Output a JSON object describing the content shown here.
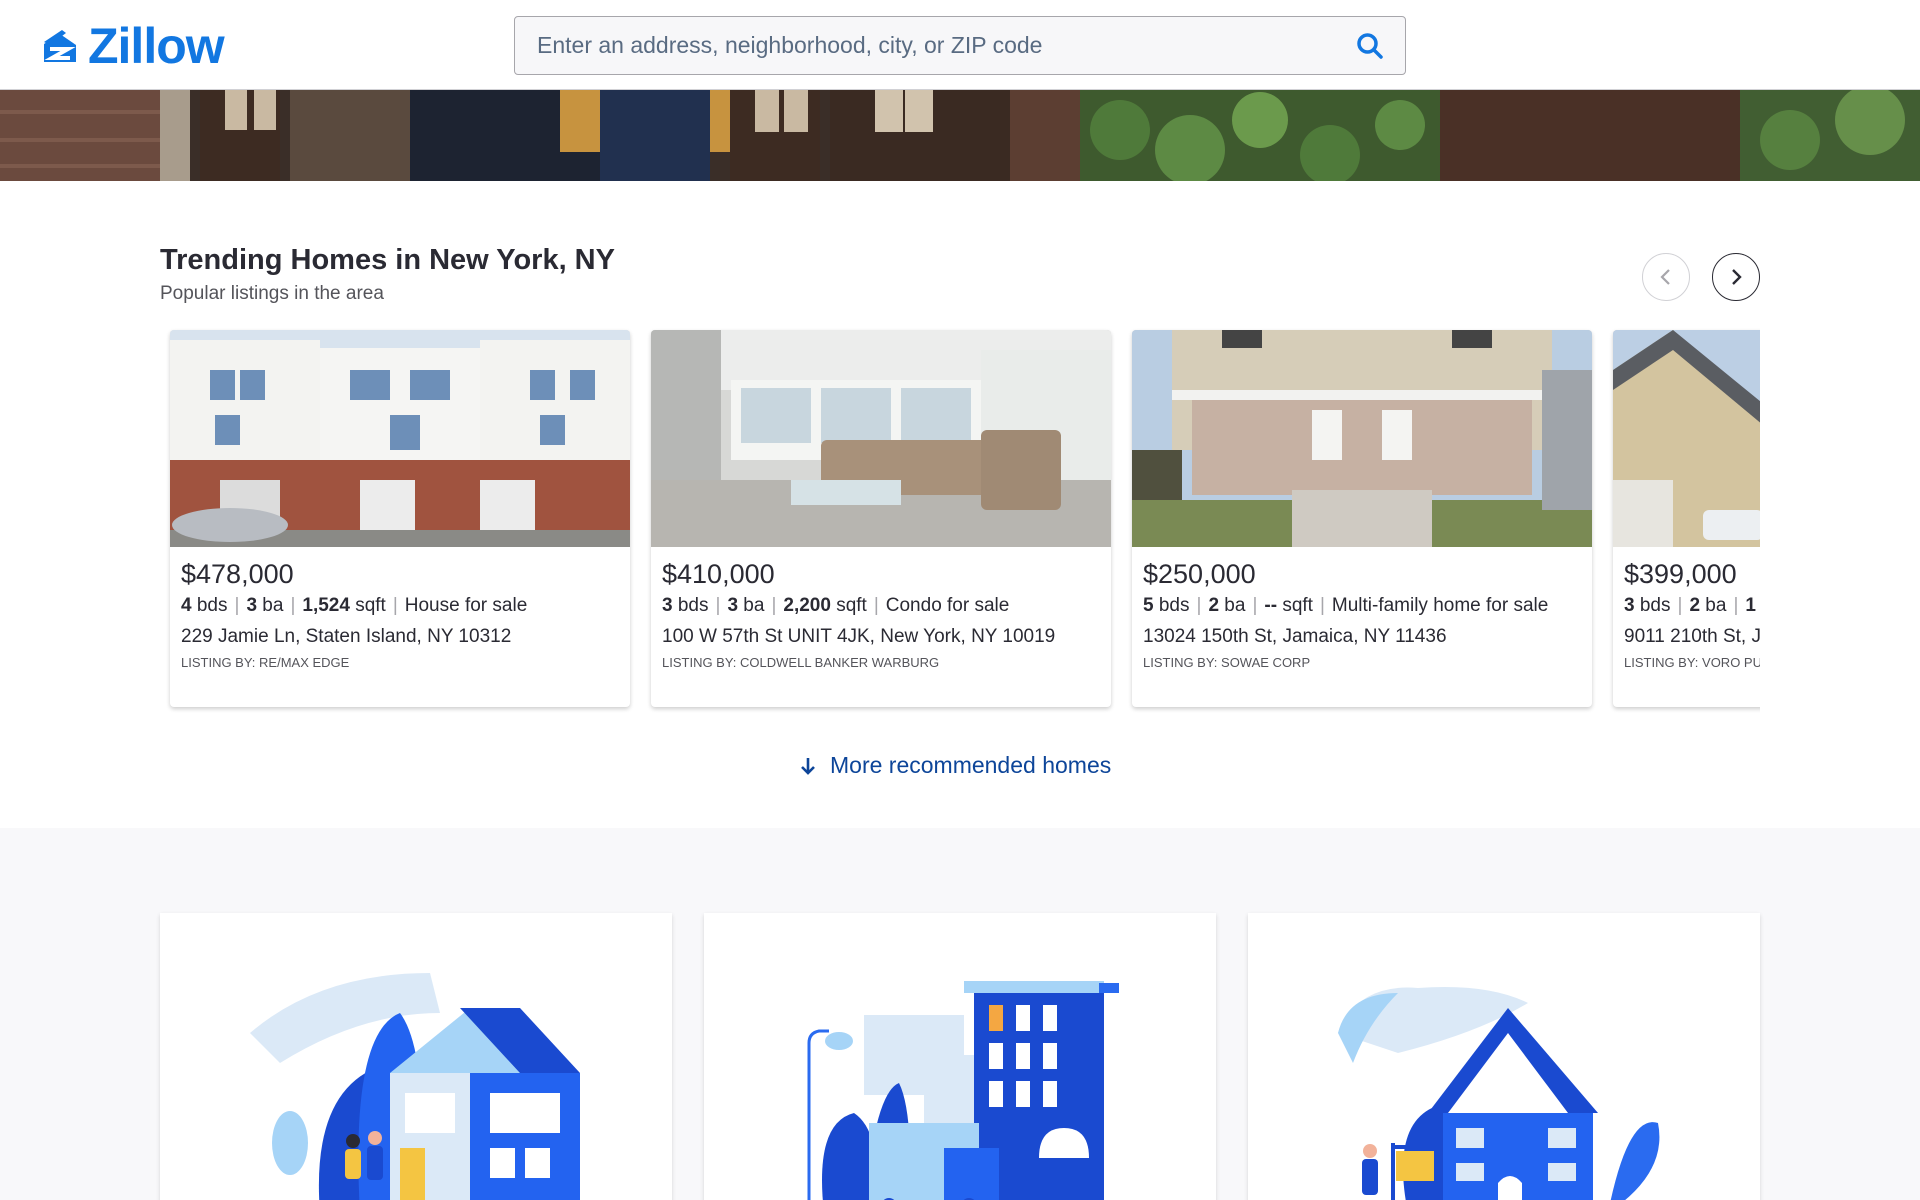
{
  "header": {
    "logo_text": "Zillow",
    "search_placeholder": "Enter an address, neighborhood, city, or ZIP code",
    "search_value": ""
  },
  "trending": {
    "title": "Trending Homes in New York, NY",
    "subtitle": "Popular listings in the area",
    "listings": [
      {
        "price": "$478,000",
        "beds": "4",
        "beds_unit": "bds",
        "baths": "3",
        "baths_unit": "ba",
        "sqft": "1,524",
        "sqft_unit": "sqft",
        "type": "House for sale",
        "address": "229 Jamie Ln, Staten Island, NY 10312",
        "broker": "LISTING BY: RE/MAX EDGE"
      },
      {
        "price": "$410,000",
        "beds": "3",
        "beds_unit": "bds",
        "baths": "3",
        "baths_unit": "ba",
        "sqft": "2,200",
        "sqft_unit": "sqft",
        "type": "Condo for sale",
        "address": "100 W 57th St UNIT 4JK, New York, NY 10019",
        "broker": "LISTING BY: COLDWELL BANKER WARBURG"
      },
      {
        "price": "$250,000",
        "beds": "5",
        "beds_unit": "bds",
        "baths": "2",
        "baths_unit": "ba",
        "sqft": "--",
        "sqft_unit": "sqft",
        "type": "Multi-family home for sale",
        "address": "13024 150th St, Jamaica, NY 11436",
        "broker": "LISTING BY: SOWAE CORP"
      },
      {
        "price": "$399,000",
        "beds": "3",
        "beds_unit": "bds",
        "baths": "2",
        "baths_unit": "ba",
        "sqft": "1",
        "sqft_unit": "",
        "type": "",
        "address": "9011 210th St, J",
        "broker": "LISTING BY: VORO PU"
      }
    ],
    "more_label": "More recommended homes"
  },
  "icons": {
    "search": "search-icon",
    "prev": "chevron-left-icon",
    "next": "chevron-right-icon",
    "more": "arrow-down-icon"
  },
  "colors": {
    "brand_blue": "#1277e1",
    "link_blue": "#0d4599",
    "text": "#2a2a33",
    "muted": "#54545a",
    "illustration_dark": "#1a4ad0",
    "illustration_light": "#a6d4f7"
  }
}
